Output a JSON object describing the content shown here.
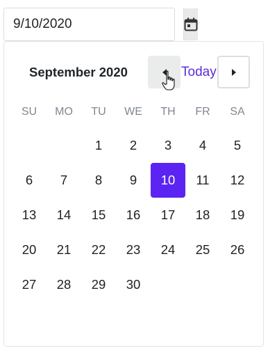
{
  "date_input": {
    "value": "9/10/2020"
  },
  "calendar": {
    "month_title": "September 2020",
    "today_label": "Today",
    "weekdays": [
      "SU",
      "MO",
      "TU",
      "WE",
      "TH",
      "FR",
      "SA"
    ],
    "selected_day": "10",
    "accent_color": "#5b24f2",
    "link_color": "#5b2bd9",
    "days": [
      "",
      "",
      "1",
      "2",
      "3",
      "4",
      "5",
      "6",
      "7",
      "8",
      "9",
      "10",
      "11",
      "12",
      "13",
      "14",
      "15",
      "16",
      "17",
      "18",
      "19",
      "20",
      "21",
      "22",
      "23",
      "24",
      "25",
      "26",
      "27",
      "28",
      "29",
      "30",
      "",
      "",
      ""
    ]
  },
  "icons": {
    "toggle": "calendar-icon",
    "prev": "caret-left-icon",
    "next": "caret-right-icon",
    "cursor": "hand-pointer-icon"
  }
}
